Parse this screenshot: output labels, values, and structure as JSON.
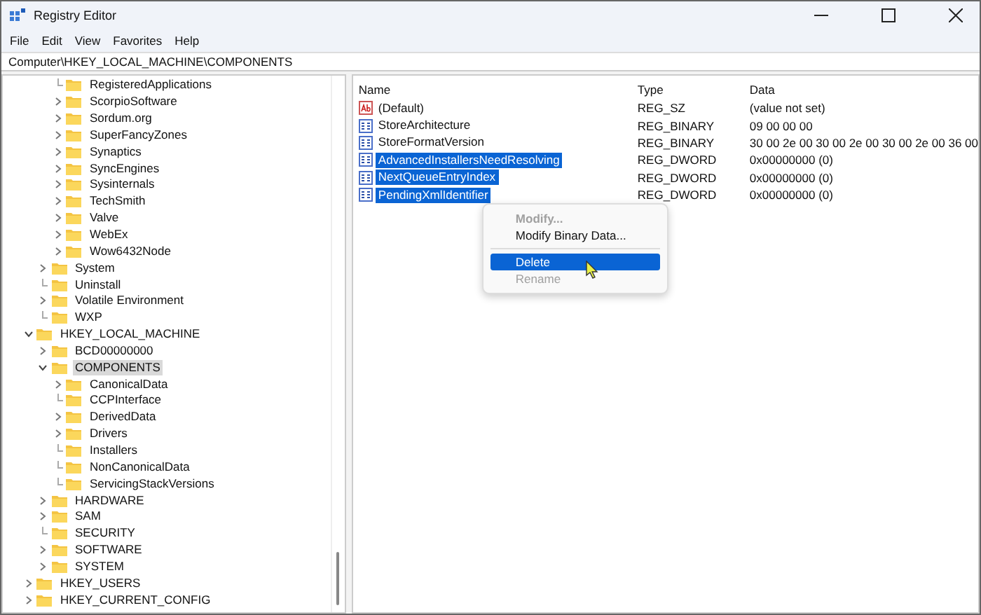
{
  "window": {
    "title": "Registry Editor"
  },
  "menu": [
    "File",
    "Edit",
    "View",
    "Favorites",
    "Help"
  ],
  "address": "Computer\\HKEY_LOCAL_MACHINE\\COMPONENTS",
  "tree": [
    {
      "children": [
        {
          "children": [
            {
              "label": "RegisteredApplications",
              "expandable": false,
              "selected": false
            },
            {
              "label": "ScorpioSoftware",
              "expandable": true,
              "expanded": false,
              "selected": false
            },
            {
              "label": "Sordum.org",
              "expandable": true,
              "expanded": false,
              "selected": false
            },
            {
              "label": "SuperFancyZones",
              "expandable": true,
              "expanded": false,
              "selected": false
            },
            {
              "label": "Synaptics",
              "expandable": true,
              "expanded": false,
              "selected": false
            },
            {
              "label": "SyncEngines",
              "expandable": true,
              "expanded": false,
              "selected": false
            },
            {
              "label": "Sysinternals",
              "expandable": true,
              "expanded": false,
              "selected": false
            },
            {
              "label": "TechSmith",
              "expandable": true,
              "expanded": false,
              "selected": false
            },
            {
              "label": "Valve",
              "expandable": true,
              "expanded": false,
              "selected": false
            },
            {
              "label": "WebEx",
              "expandable": true,
              "expanded": false,
              "selected": false
            },
            {
              "label": "Wow6432Node",
              "expandable": true,
              "expanded": false,
              "selected": false
            }
          ]
        },
        {
          "label": "System",
          "expandable": true,
          "expanded": false,
          "selected": false
        },
        {
          "label": "Uninstall",
          "expandable": false,
          "selected": false
        },
        {
          "label": "Volatile Environment",
          "expandable": true,
          "expanded": false,
          "selected": false
        },
        {
          "label": "WXP",
          "expandable": false,
          "selected": false
        }
      ]
    },
    {
      "label": "HKEY_LOCAL_MACHINE",
      "expandable": true,
      "expanded": true,
      "selected": false,
      "children": [
        {
          "label": "BCD00000000",
          "expandable": true,
          "expanded": false,
          "selected": false
        },
        {
          "label": "COMPONENTS",
          "expandable": true,
          "expanded": true,
          "selected": true,
          "children": [
            {
              "label": "CanonicalData",
              "expandable": true,
              "expanded": false,
              "selected": false
            },
            {
              "label": "CCPInterface",
              "expandable": false,
              "selected": false
            },
            {
              "label": "DerivedData",
              "expandable": true,
              "expanded": false,
              "selected": false
            },
            {
              "label": "Drivers",
              "expandable": true,
              "expanded": false,
              "selected": false
            },
            {
              "label": "Installers",
              "expandable": false,
              "selected": false
            },
            {
              "label": "NonCanonicalData",
              "expandable": false,
              "selected": false
            },
            {
              "label": "ServicingStackVersions",
              "expandable": false,
              "selected": false
            }
          ]
        },
        {
          "label": "HARDWARE",
          "expandable": true,
          "expanded": false,
          "selected": false
        },
        {
          "label": "SAM",
          "expandable": true,
          "expanded": false,
          "selected": false
        },
        {
          "label": "SECURITY",
          "expandable": false,
          "selected": false
        },
        {
          "label": "SOFTWARE",
          "expandable": true,
          "expanded": false,
          "selected": false
        },
        {
          "label": "SYSTEM",
          "expandable": true,
          "expanded": false,
          "selected": false
        }
      ]
    },
    {
      "label": "HKEY_USERS",
      "expandable": true,
      "expanded": false,
      "selected": false
    },
    {
      "label": "HKEY_CURRENT_CONFIG",
      "expandable": true,
      "expanded": false,
      "selected": false
    }
  ],
  "columns": [
    "Name",
    "Type",
    "Data"
  ],
  "values": [
    {
      "kind": "string",
      "name": "(Default)",
      "type": "REG_SZ",
      "data": "(value not set)",
      "selected": false
    },
    {
      "kind": "binary",
      "name": "StoreArchitecture",
      "type": "REG_BINARY",
      "data": "09 00 00 00",
      "selected": false
    },
    {
      "kind": "binary",
      "name": "StoreFormatVersion",
      "type": "REG_BINARY",
      "data": "30 00 2e 00 30 00 2e 00 30 00 2e 00 36 00",
      "selected": false
    },
    {
      "kind": "binary",
      "name": "AdvancedInstallersNeedResolving",
      "type": "REG_DWORD",
      "data": "0x00000000 (0)",
      "selected": true
    },
    {
      "kind": "binary",
      "name": "NextQueueEntryIndex",
      "type": "REG_DWORD",
      "data": "0x00000000 (0)",
      "selected": true
    },
    {
      "kind": "binary",
      "name": "PendingXmlIdentifier",
      "type": "REG_DWORD",
      "data": "0x00000000 (0)",
      "selected": true
    }
  ],
  "context_menu": [
    {
      "kind": "item",
      "label": "Modify...",
      "disabled": true,
      "selected": false
    },
    {
      "kind": "item",
      "label": "Modify Binary Data...",
      "disabled": false,
      "selected": false
    },
    {
      "kind": "separator"
    },
    {
      "kind": "item",
      "label": "Delete",
      "disabled": false,
      "selected": true
    },
    {
      "kind": "item",
      "label": "Rename",
      "disabled": true,
      "selected": false
    }
  ]
}
